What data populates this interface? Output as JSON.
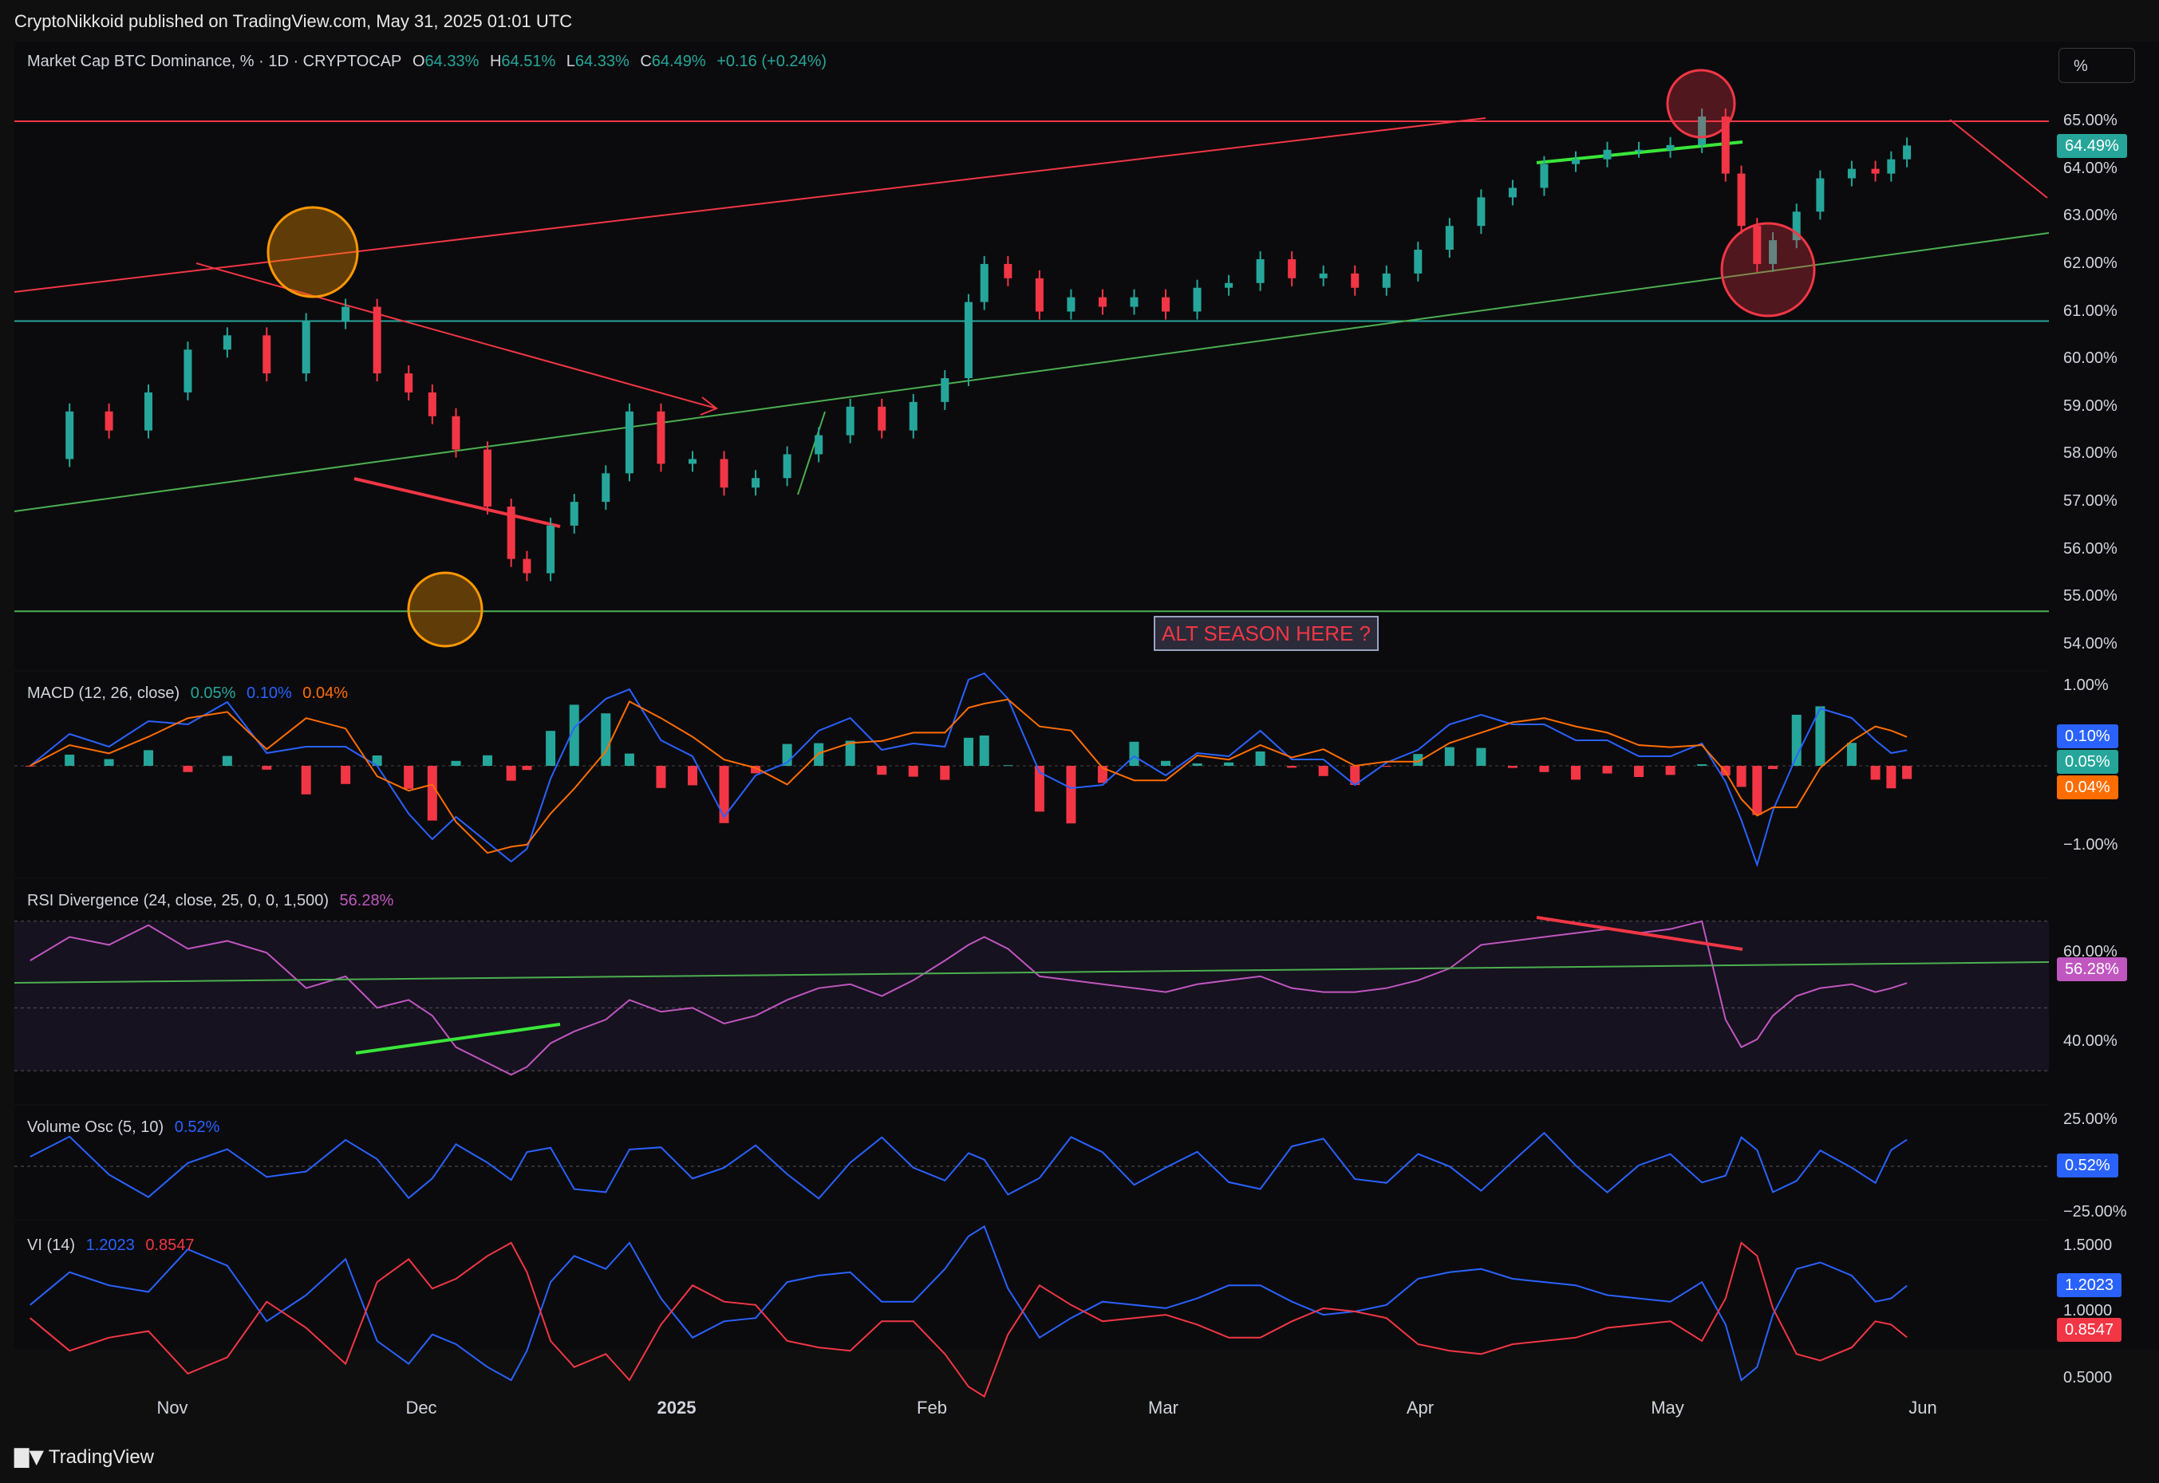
{
  "header": {
    "publisher": "CryptoNikkoid published on TradingView.com, May 31, 2025 01:01 UTC"
  },
  "main": {
    "symbol": "Market Cap BTC Dominance, % · 1D · CRYPTOCAP",
    "o_label": "O",
    "o": "64.33%",
    "h_label": "H",
    "h": "64.51%",
    "l_label": "L",
    "l": "64.33%",
    "c_label": "C",
    "c": "64.49%",
    "change": "+0.16 (+0.24%)",
    "price_tag": "64.49%",
    "scale_button": "%",
    "annotation": "ALT SEASON HERE ?",
    "y_ticks": [
      "65.00%",
      "64.00%",
      "63.00%",
      "62.00%",
      "61.00%",
      "60.00%",
      "59.00%",
      "58.00%",
      "57.00%",
      "56.00%",
      "55.00%",
      "54.00%"
    ]
  },
  "macd": {
    "title": "MACD (12, 26, close)",
    "v1": "0.05%",
    "v2": "0.10%",
    "v3": "0.04%",
    "y_ticks": [
      "1.00%",
      "−1.00%"
    ],
    "tags": [
      "0.10%",
      "0.05%",
      "0.04%"
    ]
  },
  "rsi": {
    "title": "RSI Divergence (24, close, 25, 0, 0, 1,500)",
    "value": "56.28%",
    "y_ticks": [
      "60.00%",
      "40.00%"
    ],
    "tag": "56.28%"
  },
  "volosc": {
    "title": "Volume Osc (5, 10)",
    "value": "0.52%",
    "y_ticks": [
      "25.00%",
      "−25.00%"
    ],
    "tag": "0.52%"
  },
  "vi": {
    "title": "VI (14)",
    "plus": "1.2023",
    "minus": "0.8547",
    "y_ticks": [
      "1.5000",
      "1.0000",
      "0.5000"
    ],
    "tags": [
      "1.2023",
      "0.8547"
    ]
  },
  "x_axis": [
    "Nov",
    "Dec",
    "2025",
    "Feb",
    "Mar",
    "Apr",
    "May",
    "Jun"
  ],
  "footer": {
    "brand": "TradingView"
  },
  "colors": {
    "up": "#26a69a",
    "down": "#f23645",
    "bg": "#0b0b0d",
    "macd": "#2962ff",
    "signal": "#ff6d00",
    "rsi": "#c056c0"
  },
  "chart_data": {
    "type": "line",
    "title": "Market Cap BTC Dominance, % · 1D · CRYPTOCAP",
    "ylabel": "",
    "ylim": [
      53.6,
      65.9
    ],
    "x": [
      "2024-10-05",
      "2024-10-10",
      "2024-10-15",
      "2024-10-20",
      "2024-10-25",
      "2024-10-30",
      "2024-11-04",
      "2024-11-09",
      "2024-11-14",
      "2024-11-18",
      "2024-11-22",
      "2024-11-25",
      "2024-11-28",
      "2024-12-02",
      "2024-12-05",
      "2024-12-07",
      "2024-12-10",
      "2024-12-13",
      "2024-12-17",
      "2024-12-20",
      "2024-12-24",
      "2024-12-28",
      "2025-01-01",
      "2025-01-05",
      "2025-01-09",
      "2025-01-13",
      "2025-01-17",
      "2025-01-21",
      "2025-01-25",
      "2025-01-29",
      "2025-02-01",
      "2025-02-03",
      "2025-02-06",
      "2025-02-10",
      "2025-02-14",
      "2025-02-18",
      "2025-02-22",
      "2025-02-26",
      "2025-03-02",
      "2025-03-06",
      "2025-03-10",
      "2025-03-14",
      "2025-03-18",
      "2025-03-22",
      "2025-03-26",
      "2025-03-30",
      "2025-04-03",
      "2025-04-07",
      "2025-04-11",
      "2025-04-15",
      "2025-04-19",
      "2025-04-23",
      "2025-04-27",
      "2025-05-01",
      "2025-05-05",
      "2025-05-08",
      "2025-05-10",
      "2025-05-12",
      "2025-05-14",
      "2025-05-17",
      "2025-05-20",
      "2025-05-24",
      "2025-05-27",
      "2025-05-29",
      "2025-05-31"
    ],
    "series": [
      {
        "values": [
          57.9,
          58.9,
          58.5,
          59.3,
          60.2,
          60.5,
          59.7,
          60.8,
          61.1,
          59.7,
          59.3,
          58.8,
          58.1,
          56.9,
          55.8,
          55.5,
          56.5,
          57.0,
          57.6,
          58.9,
          57.8,
          57.9,
          57.3,
          57.5,
          58.0,
          58.4,
          59.0,
          58.5,
          59.1,
          59.6,
          61.2,
          62.0,
          61.7,
          61.0,
          61.3,
          61.1,
          61.3,
          61.0,
          61.5,
          61.6,
          62.1,
          61.7,
          61.8,
          61.5,
          61.8,
          62.3,
          62.8,
          63.4,
          63.6,
          64.1,
          64.2,
          64.4,
          64.4,
          64.5,
          65.1,
          63.9,
          62.8,
          62.0,
          62.5,
          63.1,
          63.8,
          64.0,
          63.9,
          64.2,
          64.49
        ]
      }
    ],
    "indicators": {
      "rsi_ylim": [
        30,
        75
      ],
      "rsi_levels": [
        60,
        40
      ],
      "rsi": [
        62,
        68,
        66,
        71,
        65,
        67,
        64,
        55,
        58,
        50,
        52,
        48,
        40,
        36,
        33,
        35,
        41,
        44,
        47,
        52,
        49,
        50,
        46,
        48,
        52,
        55,
        56,
        53,
        57,
        62,
        66,
        68,
        65,
        58,
        57,
        56,
        55,
        54,
        56,
        57,
        58,
        55,
        54,
        54,
        55,
        57,
        60,
        66,
        67,
        68,
        69,
        70,
        69,
        70,
        72,
        47,
        40,
        42,
        48,
        53,
        55,
        56,
        54,
        55,
        56.28
      ]
    }
  }
}
